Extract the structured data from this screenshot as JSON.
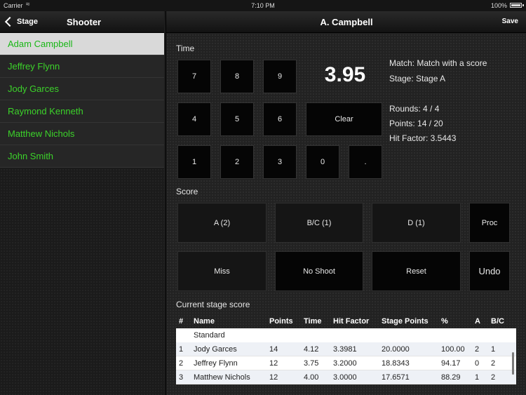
{
  "status_bar": {
    "carrier": "Carrier",
    "time": "7:10 PM",
    "battery": "100%"
  },
  "left_nav": {
    "back_label": "Stage",
    "title": "Shooter"
  },
  "shooters": [
    "Adam Campbell",
    "Jeffrey Flynn",
    "Jody Garces",
    "Raymond Kenneth",
    "Matthew Nichols",
    "John Smith"
  ],
  "selected_shooter": "Adam Campbell",
  "right_nav": {
    "title": "A. Campbell",
    "save_label": "Save"
  },
  "time_section": {
    "label": "Time",
    "value": "3.95",
    "keys": {
      "k7": "7",
      "k8": "8",
      "k9": "9",
      "k4": "4",
      "k5": "5",
      "k6": "6",
      "k1": "1",
      "k2": "2",
      "k3": "3",
      "k0": "0",
      "dot": ".",
      "clear": "Clear"
    }
  },
  "info": {
    "match": "Match: Match with a score",
    "stage": "Stage: Stage A",
    "rounds": "Rounds: 4 / 4",
    "points": "Points: 14 / 20",
    "hit_factor": "Hit Factor: 3.5443"
  },
  "score_section": {
    "label": "Score",
    "buttons": {
      "a": "A (2)",
      "bc": "B/C (1)",
      "d": "D (1)",
      "proc": "Proc",
      "miss": "Miss",
      "no_shoot": "No Shoot",
      "reset": "Reset",
      "undo": "Undo"
    }
  },
  "table": {
    "label": "Current stage score",
    "headers": [
      "#",
      "Name",
      "Points",
      "Time",
      "Hit Factor",
      "Stage Points",
      "%",
      "A",
      "B/C"
    ],
    "section": "Standard",
    "rows": [
      [
        "1",
        "Jody Garces",
        "14",
        "4.12",
        "3.3981",
        "20.0000",
        "100.00",
        "2",
        "1"
      ],
      [
        "2",
        "Jeffrey Flynn",
        "12",
        "3.75",
        "3.2000",
        "18.8343",
        "94.17",
        "0",
        "2"
      ],
      [
        "3",
        "Matthew Nichols",
        "12",
        "4.00",
        "3.0000",
        "17.6571",
        "88.29",
        "1",
        "2"
      ]
    ]
  },
  "colors": {
    "shooter_text": "#3cd22a",
    "selected_bg": "#d9d9d9"
  }
}
